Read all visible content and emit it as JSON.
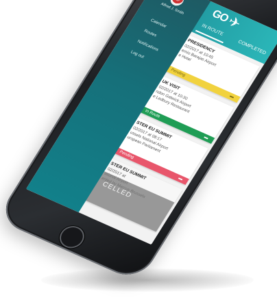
{
  "app": {
    "logo_text": "GO",
    "tabs": {
      "in_route": "IN ROUTE",
      "completed": "COMPLETED"
    }
  },
  "sidebar": {
    "user_name": "Alfred J. Smith",
    "items": [
      {
        "label": "Calendar"
      },
      {
        "label": "Routes"
      },
      {
        "label": "Notifications"
      },
      {
        "label": "Log out"
      }
    ]
  },
  "trips": [
    {
      "title": "PRESIDENCY",
      "lines": [
        "02/2017 at 10:45",
        "ernio Barajas Airport",
        "e Hotel"
      ],
      "status": "Pending",
      "status_color": "#f1d23e"
    },
    {
      "title": "UK VISIT",
      "lines": [
        "02/2017 at 10:30",
        "ndon Gatwick Airport",
        "e Ledbury Restaurant"
      ],
      "status": "In Route",
      "status_color": "#1f9d55"
    },
    {
      "title": "STER EU SUMMIT",
      "lines": [
        "02/2017 at 08:17",
        "ussels National Airport",
        "uropean Parliament"
      ],
      "status": "Pending",
      "status_color": "#e8566b"
    },
    {
      "title": "STER EU SUMMIT",
      "lines": [
        "02/2017 at",
        "ational Airport",
        "ented by Marcus Brussels"
      ],
      "status": "CELLED"
    }
  ],
  "colors": {
    "header_start": "#1c8c96",
    "header_end": "#2bb6b8",
    "sidebar": "#16707a"
  }
}
